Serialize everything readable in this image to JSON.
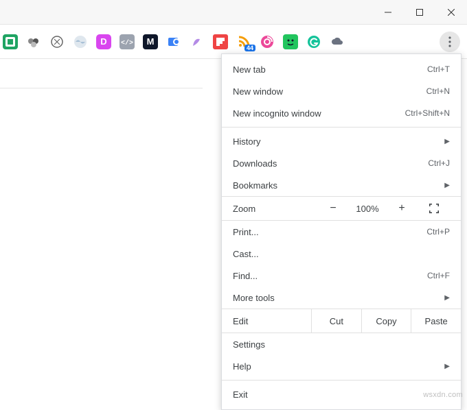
{
  "window_controls": {
    "minimize": "🗕",
    "maximize": "🗖",
    "close": "🗙"
  },
  "extensions": {
    "badge_count": "44"
  },
  "menu": {
    "new_tab": {
      "label": "New tab",
      "shortcut": "Ctrl+T"
    },
    "new_window": {
      "label": "New window",
      "shortcut": "Ctrl+N"
    },
    "new_incognito": {
      "label": "New incognito window",
      "shortcut": "Ctrl+Shift+N"
    },
    "history": {
      "label": "History"
    },
    "downloads": {
      "label": "Downloads",
      "shortcut": "Ctrl+J"
    },
    "bookmarks": {
      "label": "Bookmarks"
    },
    "zoom": {
      "label": "Zoom",
      "value": "100%",
      "minus": "−",
      "plus": "+"
    },
    "print": {
      "label": "Print...",
      "shortcut": "Ctrl+P"
    },
    "cast": {
      "label": "Cast..."
    },
    "find": {
      "label": "Find...",
      "shortcut": "Ctrl+F"
    },
    "more_tools": {
      "label": "More tools"
    },
    "edit": {
      "label": "Edit",
      "cut": "Cut",
      "copy": "Copy",
      "paste": "Paste"
    },
    "settings": {
      "label": "Settings"
    },
    "help": {
      "label": "Help"
    },
    "exit": {
      "label": "Exit"
    }
  },
  "watermark": "wsxdn.com"
}
